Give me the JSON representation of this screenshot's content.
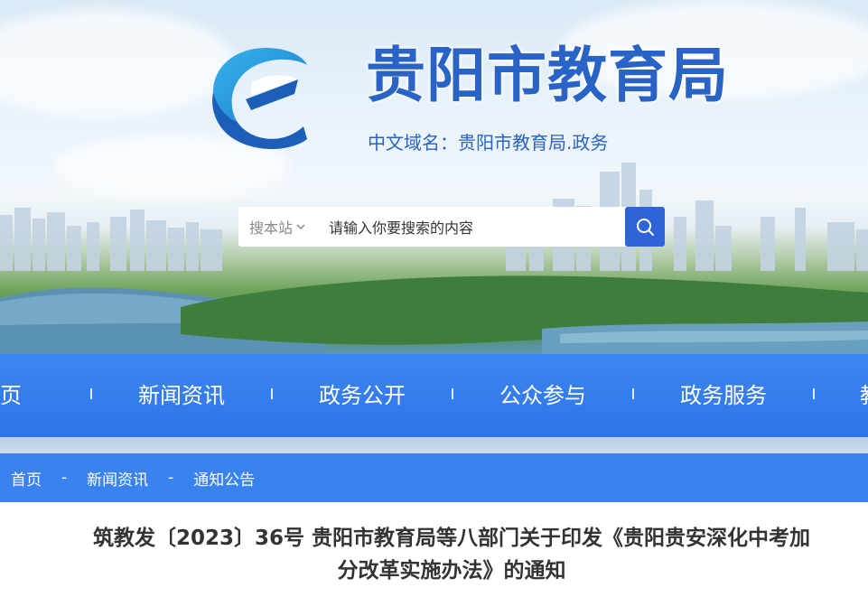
{
  "site": {
    "title": "贵阳市教育局",
    "domain_line": "中文域名：贵阳市教育局.政务"
  },
  "search": {
    "scope_label": "搜本站",
    "placeholder": "请输入你要搜索的内容"
  },
  "nav": {
    "items": [
      {
        "label": "首页"
      },
      {
        "label": "新闻资讯"
      },
      {
        "label": "政务公开"
      },
      {
        "label": "公众参与"
      },
      {
        "label": "政务服务"
      },
      {
        "label": "教"
      }
    ]
  },
  "breadcrumb": {
    "items": [
      "首页",
      "新闻资讯",
      "通知公告"
    ],
    "separator": "-"
  },
  "article": {
    "title_line1": "筑教发〔2023〕36号 贵阳市教育局等八部门关于印发《贵阳贵安深化中考加",
    "title_line2": "分改革实施办法》的通知"
  },
  "colors": {
    "brand_blue": "#2a63c6",
    "nav_blue": "#3d86f2",
    "breadcrumb_blue": "#3a83ef",
    "search_button": "#2e64d8"
  },
  "icons": {
    "logo": "e-logo-icon",
    "search": "search-icon",
    "dropdown": "chevron-down-icon"
  }
}
